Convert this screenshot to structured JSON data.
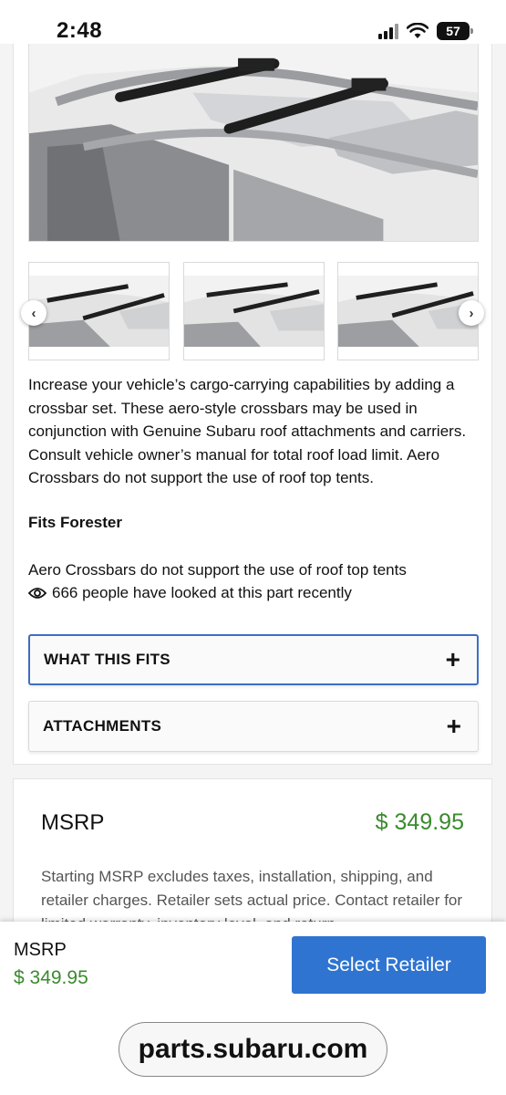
{
  "status": {
    "time": "2:48",
    "battery": "57",
    "icons": [
      "signal-icon",
      "wifi-icon",
      "battery-icon"
    ]
  },
  "product": {
    "gallery": {
      "main_image": "roof-crossbars-main-image",
      "thumbnails": [
        "crossbar-thumbnail-1",
        "crossbar-thumbnail-2",
        "crossbar-thumbnail-3"
      ],
      "prev_icon": "‹",
      "next_icon": "›"
    },
    "description": "Increase your vehicle’s cargo-carrying capabilities by adding a crossbar set. These aero-style crossbars may be used in conjunction with Genuine Subaru roof attachments and carriers. Consult vehicle owner’s manual for total roof load limit. Aero Crossbars do not support the use of roof top tents.",
    "fits": "Fits Forester",
    "warning": "Aero Crossbars do not support the use of roof top tents",
    "views_text": "666 people have looked at this part recently",
    "accordions": [
      {
        "label": "WHAT THIS FITS",
        "icon": "+"
      },
      {
        "label": "ATTACHMENTS",
        "icon": "+"
      }
    ]
  },
  "pricing": {
    "title": "MSRP",
    "price": "$ 349.95",
    "note": "Starting MSRP excludes taxes, installation, shipping, and retailer charges. Retailer sets actual price. Contact retailer for limited warranty, inventory level, and return"
  },
  "sticky": {
    "label": "MSRP",
    "price": "$ 349.95",
    "button": "Select Retailer"
  },
  "browser": {
    "url": "parts.subaru.com"
  },
  "colors": {
    "price_green": "#3b8a2e",
    "button_blue": "#2f74d0",
    "focus_border": "#3f6ec3"
  }
}
